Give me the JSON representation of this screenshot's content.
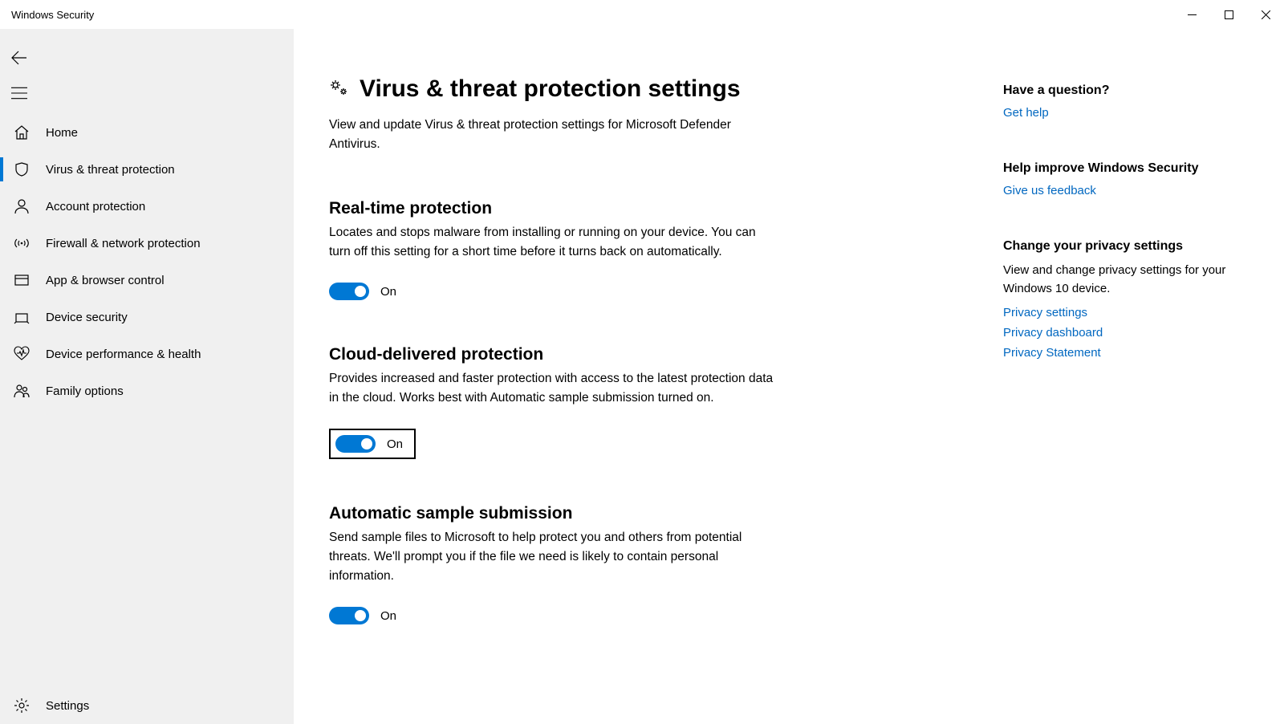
{
  "window": {
    "title": "Windows Security"
  },
  "sidebar": {
    "items": [
      {
        "label": "Home"
      },
      {
        "label": "Virus & threat protection"
      },
      {
        "label": "Account protection"
      },
      {
        "label": "Firewall & network protection"
      },
      {
        "label": "App & browser control"
      },
      {
        "label": "Device security"
      },
      {
        "label": "Device performance & health"
      },
      {
        "label": "Family options"
      }
    ],
    "settings_label": "Settings"
  },
  "page": {
    "title": "Virus & threat protection settings",
    "description": "View and update Virus & threat protection settings for Microsoft Defender Antivirus."
  },
  "sections": {
    "realtime": {
      "title": "Real-time protection",
      "desc": "Locates and stops malware from installing or running on your device. You can turn off this setting for a short time before it turns back on automatically.",
      "state": "On"
    },
    "cloud": {
      "title": "Cloud-delivered protection",
      "desc": "Provides increased and faster protection with access to the latest protection data in the cloud. Works best with Automatic sample submission turned on.",
      "state": "On"
    },
    "sample": {
      "title": "Automatic sample submission",
      "desc": "Send sample files to Microsoft to help protect you and others from potential threats. We'll prompt you if the file we need is likely to contain personal information.",
      "state": "On"
    }
  },
  "rightpane": {
    "question": {
      "title": "Have a question?",
      "link": "Get help"
    },
    "improve": {
      "title": "Help improve Windows Security",
      "link": "Give us feedback"
    },
    "privacy": {
      "title": "Change your privacy settings",
      "desc": "View and change privacy settings for your Windows 10 device.",
      "links": [
        "Privacy settings",
        "Privacy dashboard",
        "Privacy Statement"
      ]
    }
  }
}
